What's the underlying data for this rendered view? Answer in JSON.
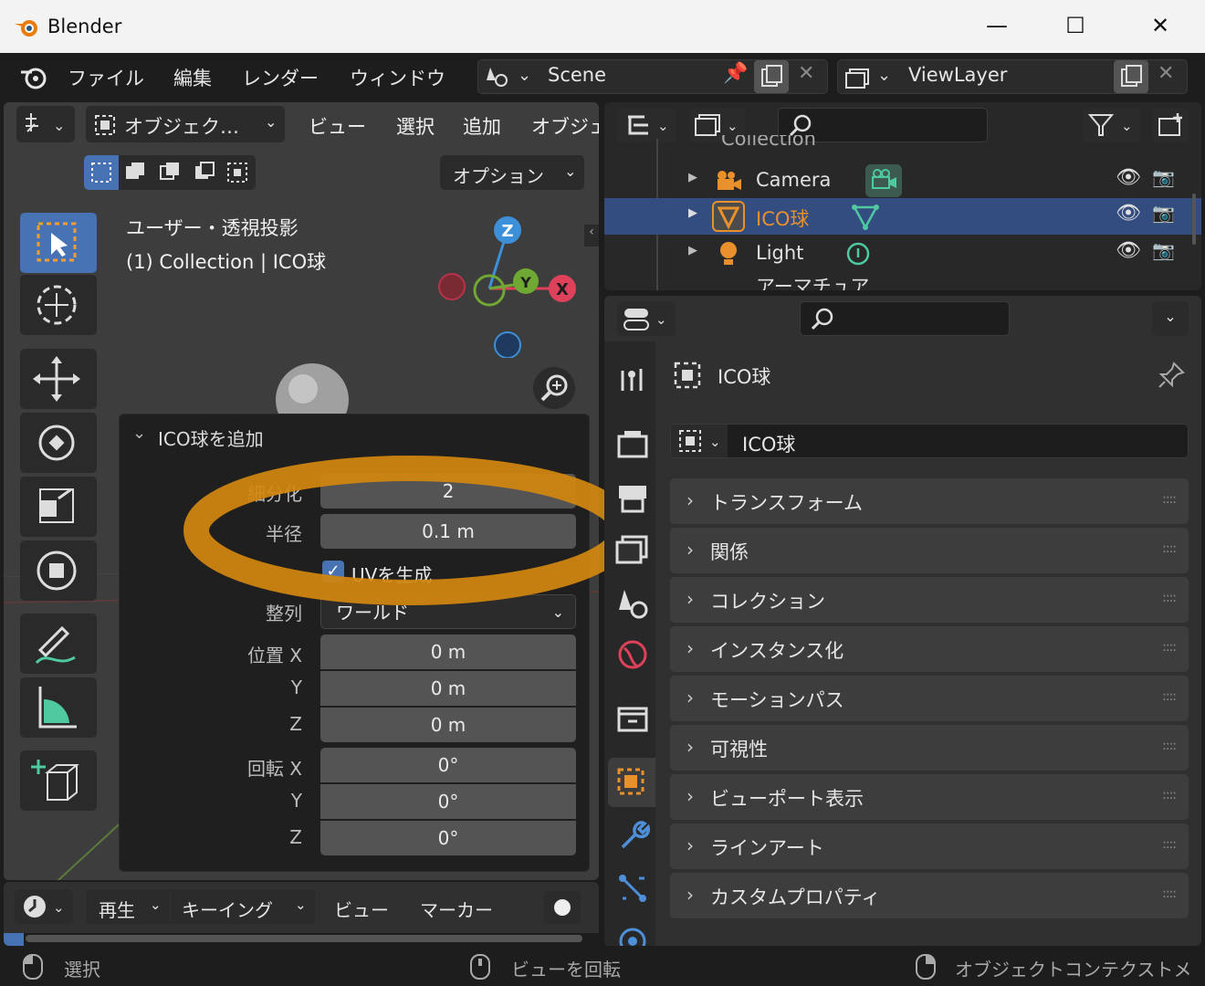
{
  "window": {
    "title": "Blender",
    "controls": [
      "minimize",
      "maximize",
      "close"
    ]
  },
  "menu": [
    "ファイル",
    "編集",
    "レンダー",
    "ウィンドウ"
  ],
  "scene": {
    "name": "Scene"
  },
  "view_layer": {
    "name": "ViewLayer"
  },
  "viewport_header": {
    "mode": "オブジェク…",
    "menus": [
      "ビュー",
      "選択",
      "追加",
      "オブジェ"
    ],
    "options": "オプション"
  },
  "viewport": {
    "view_name": "ユーザー・透視投影",
    "collection_info": "(1) Collection | ICO球",
    "gizmo_axes": [
      "Z",
      "Y",
      "X"
    ]
  },
  "redo_panel": {
    "title": "ICO球を追加",
    "rows": [
      {
        "label": "細分化",
        "value": "2"
      },
      {
        "label": "半径",
        "value": "0.1 m"
      },
      {
        "label": "",
        "value": "UVを生成"
      },
      {
        "label": "整列",
        "value": "ワールド"
      },
      {
        "label": "位置 X",
        "value": "0 m"
      },
      {
        "label": "Y",
        "value": "0 m"
      },
      {
        "label": "Z",
        "value": "0 m"
      },
      {
        "label": "回転 X",
        "value": "0°"
      },
      {
        "label": "Y",
        "value": "0°"
      },
      {
        "label": "Z",
        "value": "0°"
      }
    ],
    "highlight_color": "#d4870f"
  },
  "outliner": {
    "items": [
      {
        "name": "Collection"
      },
      {
        "name": "Camera"
      },
      {
        "name": "ICO球",
        "selected": true
      },
      {
        "name": "Light"
      },
      {
        "name": "アーマチュア"
      }
    ]
  },
  "properties": {
    "object_name_header": "ICO球",
    "object_name_field": "ICO球",
    "panels": [
      "トランスフォーム",
      "関係",
      "コレクション",
      "インスタンス化",
      "モーションパス",
      "可視性",
      "ビューポート表示",
      "ラインアート",
      "カスタムプロパティ"
    ]
  },
  "timeline": {
    "menus": [
      "再生",
      "キーイング",
      "ビュー",
      "マーカー"
    ]
  },
  "status": {
    "left": "選択",
    "middle": "ビューを回転",
    "right": "オブジェクトコンテクストメ"
  },
  "colors": {
    "accent": "#4772b3",
    "selection": "#334d80",
    "orange": "#e8912c"
  }
}
